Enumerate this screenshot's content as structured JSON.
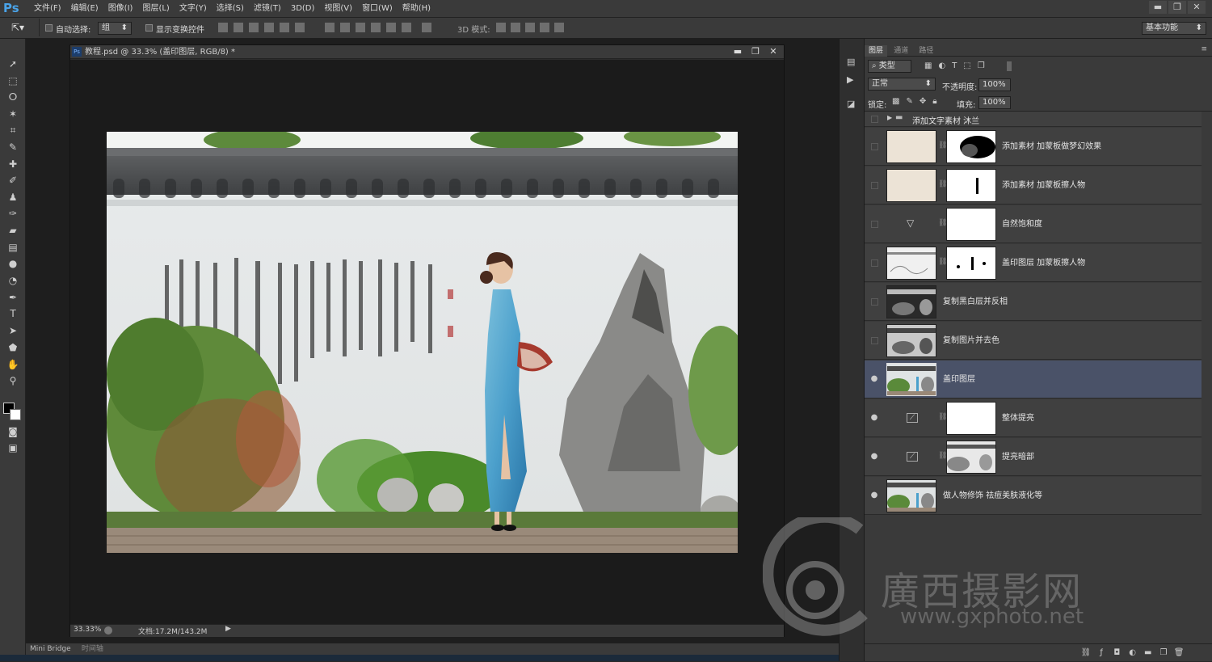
{
  "app": {
    "logo": "Ps"
  },
  "menu": [
    "文件(F)",
    "编辑(E)",
    "图像(I)",
    "图层(L)",
    "文字(Y)",
    "选择(S)",
    "滤镜(T)",
    "3D(D)",
    "视图(V)",
    "窗口(W)",
    "帮助(H)"
  ],
  "window_controls": [
    "▬",
    "❐",
    "✕"
  ],
  "options": {
    "auto_select_label": "自动选择:",
    "auto_select_value": "组",
    "show_transform_label": "显示变换控件",
    "mode3d_label": "3D 模式:",
    "workspace": "基本功能"
  },
  "document": {
    "title": "教程.psd @ 33.3% (盖印图层, RGB/8) *",
    "zoom": "33.33%",
    "doc_size": "文档:17.2M/143.2M"
  },
  "bottom_tabs": [
    "Mini Bridge",
    "时间轴"
  ],
  "panel": {
    "tabs": [
      "图层",
      "通道",
      "路径"
    ],
    "filter_kind": "类型",
    "blend_mode": "正常",
    "opacity_label": "不透明度:",
    "opacity_value": "100%",
    "lock_label": "锁定:",
    "fill_label": "填充:",
    "fill_value": "100%",
    "group_name": "添加文字素材   沐兰",
    "layers": [
      {
        "name": "添加素材   加蒙板做梦幻效果",
        "visible": false,
        "selected": false
      },
      {
        "name": "添加素材   加蒙板擦人物",
        "visible": false,
        "selected": false
      },
      {
        "name": "自然饱和度",
        "visible": false,
        "selected": false
      },
      {
        "name": "盖印图层   加蒙板擦人物",
        "visible": false,
        "selected": false
      },
      {
        "name": "复制黑白层并反相",
        "visible": false,
        "selected": false
      },
      {
        "name": "复制图片并去色",
        "visible": false,
        "selected": false
      },
      {
        "name": "盖印图层",
        "visible": true,
        "selected": true
      },
      {
        "name": "整体提亮",
        "visible": true,
        "selected": false
      },
      {
        "name": "提亮暗部",
        "visible": true,
        "selected": false
      },
      {
        "name": "做人物修饰   祛痘美肤液化等",
        "visible": true,
        "selected": false
      }
    ]
  },
  "watermark": {
    "name": "廣西摄影网",
    "url": "www.gxphoto.net"
  }
}
